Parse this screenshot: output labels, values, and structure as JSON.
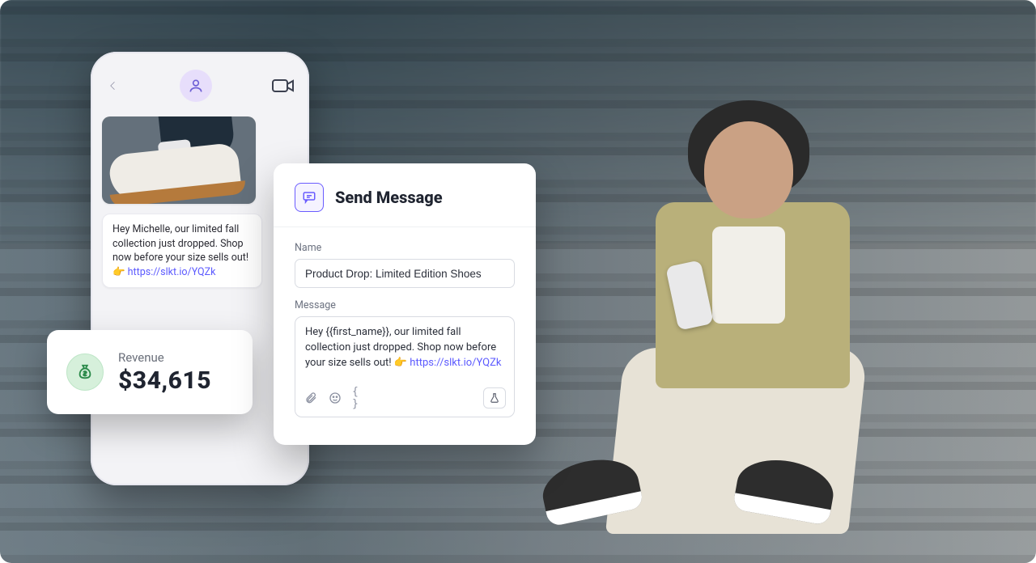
{
  "phone": {
    "bubble": {
      "text_prefix": "Hey Michelle, our limited fall collection just dropped. Shop now before your size sells out! 👉 ",
      "link_text": "https://slkt.io/YQZk"
    }
  },
  "revenue": {
    "label": "Revenue",
    "value": "$34,615"
  },
  "panel": {
    "title": "Send Message",
    "name_label": "Name",
    "name_value": "Product Drop: Limited Edition Shoes",
    "message_label": "Message",
    "message_text_prefix": "Hey {{first_name}}, our limited fall collection just dropped. Shop now before your size sells out! 👉 ",
    "message_link_text": "https://slkt.io/YQZk",
    "curly_label": "{ }"
  }
}
